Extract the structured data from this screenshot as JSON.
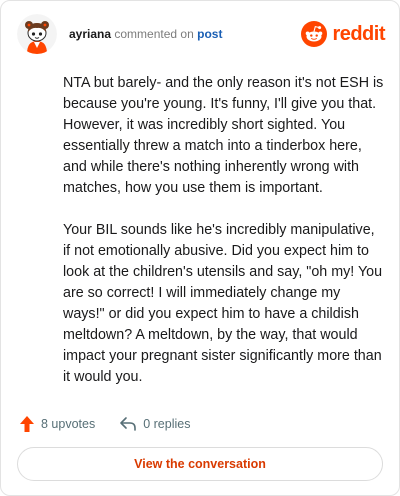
{
  "header": {
    "username": "ayriana",
    "action_text": "commented on",
    "post_link": "post",
    "brand": "reddit"
  },
  "comment": {
    "paragraphs": [
      "NTA but barely- and the only reason it's not ESH is because you're young. It's funny, I'll give you that. However, it was incredibly short sighted. You essentially threw a match into a tinderbox here, and while there's nothing inherently wrong with matches, how you use them is important.",
      "Your BIL sounds like he's incredibly manipulative, if not emotionally abusive. Did you expect him to look at the children's utensils and say, \"oh my! You are so correct! I will immediately change my ways!\" or did you expect him to have a childish meltdown? A meltdown, by the way, that would impact your pregnant sister significantly more than it would you."
    ]
  },
  "actions": {
    "upvotes": "8 upvotes",
    "replies": "0 replies"
  },
  "cta": {
    "label": "View the conversation"
  },
  "colors": {
    "brand": "#ff4500",
    "link": "#1a5fb4",
    "cta_text": "#d93a00"
  },
  "icons": [
    "avatar",
    "reddit-logo-icon",
    "upvote-arrow-icon",
    "reply-arrow-icon"
  ]
}
